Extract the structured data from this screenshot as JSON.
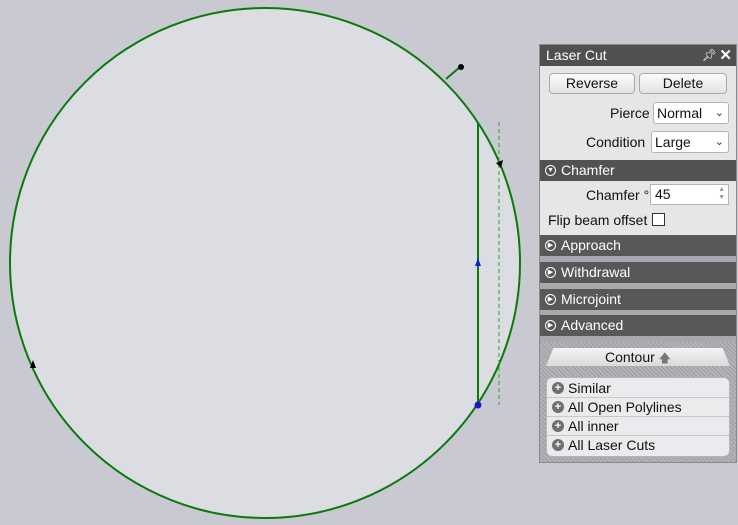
{
  "colors": {
    "background": "#c9c9d2",
    "shape_fill": "#dcdde3",
    "contour_line": "#0a7a0a",
    "offset_line": "#22aa22",
    "marker": "#1a1acc",
    "panel_header": "#505050"
  },
  "panel": {
    "title": "Laser Cut",
    "pin_icon": "pin-icon",
    "close_icon": "close-icon",
    "reverse_label": "Reverse",
    "delete_label": "Delete",
    "pierce_label": "Pierce",
    "pierce_value": "Normal",
    "condition_label": "Condition",
    "condition_value": "Large",
    "sections": {
      "chamfer": "Chamfer",
      "approach": "Approach",
      "withdrawal": "Withdrawal",
      "microjoint": "Microjoint",
      "advanced": "Advanced"
    },
    "chamfer_field_label": "Chamfer °",
    "chamfer_value": "45",
    "flip_beam_label": "Flip beam offset",
    "flip_beam_checked": false,
    "contour_tab": "Contour",
    "contour_items": [
      "Similar",
      "All Open Polylines",
      "All inner",
      "All Laser Cuts"
    ]
  }
}
